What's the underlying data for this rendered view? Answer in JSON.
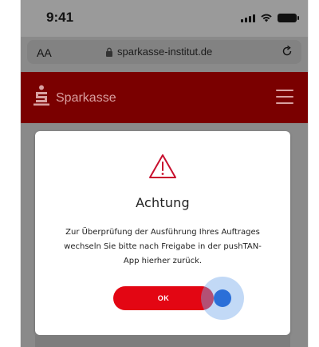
{
  "status_bar": {
    "time": "9:41",
    "icons": [
      "signal-icon",
      "wifi-icon",
      "battery-icon"
    ]
  },
  "browser": {
    "text_size_label": "AA",
    "url": "sparkasse-institut.de",
    "icons": [
      "lock-icon",
      "reload-icon"
    ]
  },
  "header": {
    "brand_name": "Sparkasse",
    "icons": [
      "sparkasse-logo-icon",
      "menu-icon"
    ],
    "brand_color": "#e30613"
  },
  "dialog": {
    "icon": "warning-icon",
    "title": "Achtung",
    "message": "Zur Überprüfung der Ausführung Ihres Auftrages wechseln Sie bitte nach Freigabe in der pushTAN-App hierher zurück.",
    "ok_label": "OK"
  },
  "colors": {
    "accent": "#e30613",
    "tap_indicator": "#2b6fd8"
  }
}
